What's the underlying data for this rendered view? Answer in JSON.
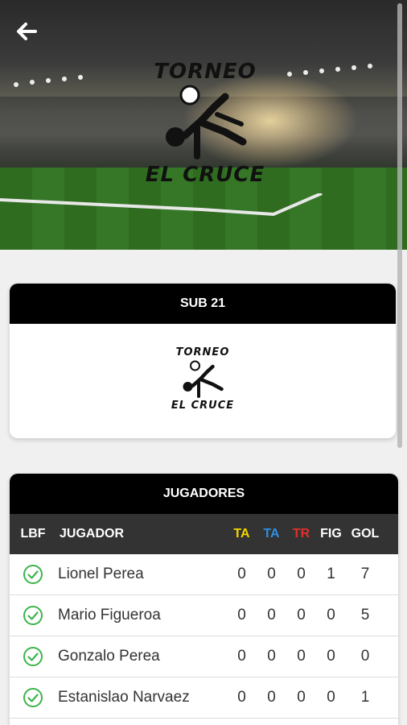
{
  "header": {
    "back_icon": "arrow-left-icon",
    "logo": {
      "line1": "TORNEO",
      "line2": "EL CRUCE"
    }
  },
  "category_card": {
    "title": "SUB 21",
    "logo": {
      "line1": "TORNEO",
      "line2": "EL CRUCE"
    }
  },
  "players_card": {
    "title": "JUGADORES",
    "columns": [
      "LBF",
      "JUGADOR",
      "TA",
      "TA",
      "TR",
      "FIG",
      "GOL"
    ],
    "column_colors": {
      "ta_yellow": "#f2d600",
      "ta_blue": "#2f8fe0",
      "tr_red": "#e0302a",
      "default": "#ffffff"
    },
    "check_color": "#3cb44a",
    "rows": [
      {
        "name": "Lionel Perea",
        "ta1": "0",
        "ta2": "0",
        "tr": "0",
        "fig": "1",
        "gol": "7"
      },
      {
        "name": "Mario Figueroa",
        "ta1": "0",
        "ta2": "0",
        "tr": "0",
        "fig": "0",
        "gol": "5"
      },
      {
        "name": "Gonzalo Perea",
        "ta1": "0",
        "ta2": "0",
        "tr": "0",
        "fig": "0",
        "gol": "0"
      },
      {
        "name": "Estanislao Narvaez",
        "ta1": "0",
        "ta2": "0",
        "tr": "0",
        "fig": "0",
        "gol": "1"
      }
    ]
  }
}
